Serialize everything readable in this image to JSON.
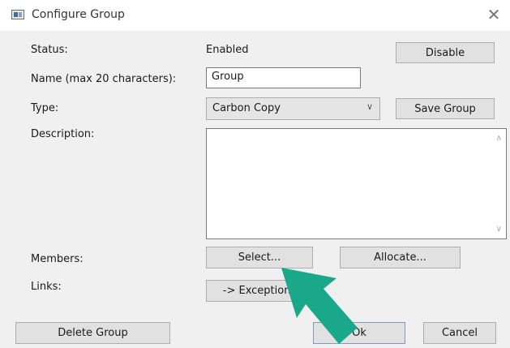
{
  "window": {
    "title": "Configure Group",
    "close_glyph": "✕"
  },
  "status": {
    "label": "Status:",
    "value": "Enabled",
    "toggle_button": "Disable"
  },
  "name": {
    "label": "Name (max 20 characters):",
    "value": "Group"
  },
  "type": {
    "label": "Type:",
    "selected": "Carbon Copy",
    "save_button": "Save Group"
  },
  "description": {
    "label": "Description:",
    "value": ""
  },
  "members": {
    "label": "Members:",
    "select_button": "Select...",
    "allocate_button": "Allocate..."
  },
  "links": {
    "label": "Links:",
    "exceptions_button": "-> Exceptions"
  },
  "footer": {
    "delete_button": "Delete Group",
    "ok_button": "Ok",
    "cancel_button": "Cancel"
  },
  "annotation": {
    "arrow_color": "#1aa88a",
    "arrow_points_to": "members.select_button"
  },
  "icons": {
    "app": "app-window-icon",
    "close": "close-icon",
    "dropdown": "chevron-down-icon"
  }
}
